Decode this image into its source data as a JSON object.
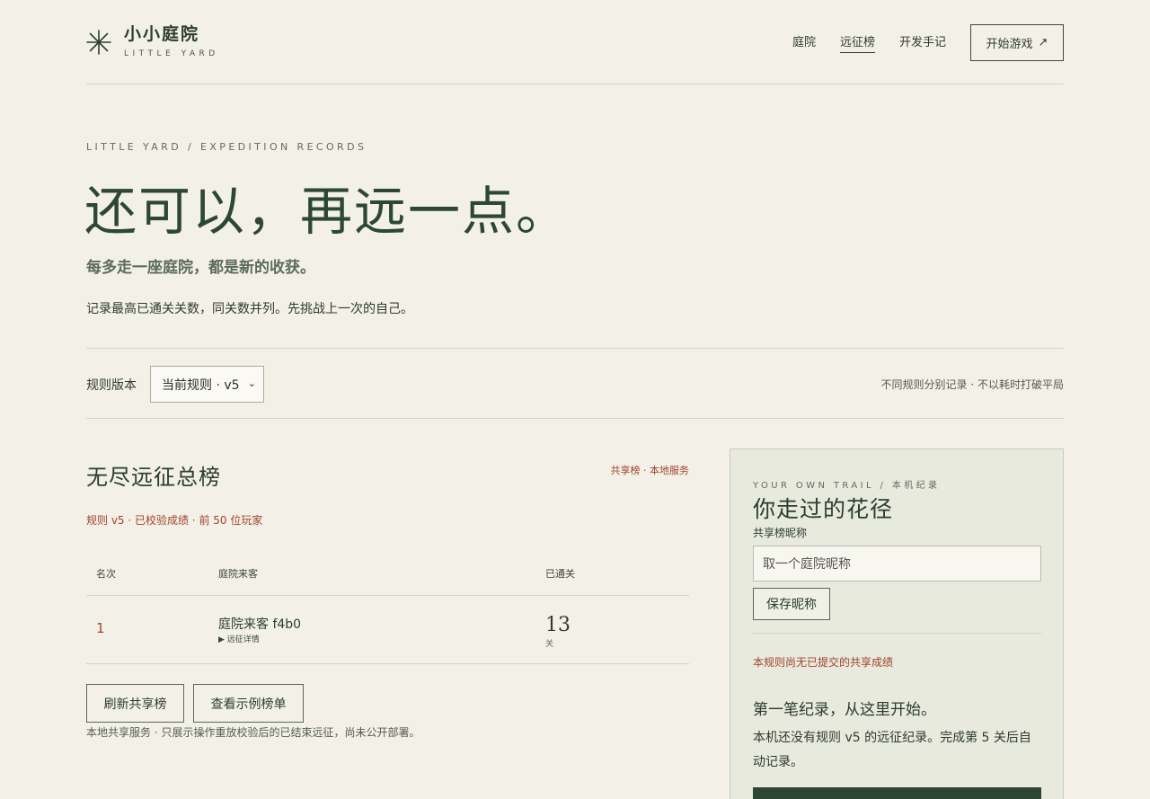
{
  "brand": {
    "name_cn": "小小庭院",
    "name_en": "LITTLE YARD"
  },
  "nav": {
    "items": [
      {
        "label": "庭院"
      },
      {
        "label": "远征榜",
        "active": true
      },
      {
        "label": "开发手记"
      }
    ],
    "start_label": "开始游戏",
    "start_icon": "arrow-up-right-icon"
  },
  "hero": {
    "eyebrow": "LITTLE YARD / EXPEDITION RECORDS",
    "title": "还可以，再远一点。",
    "subtitle": "每多走一座庭院，都是新的收获。",
    "description": "记录最高已通关关数，同关数并列。先挑战上一次的自己。"
  },
  "rules": {
    "label": "规则版本",
    "selected": "当前规则 · v5",
    "note": "不同规则分别记录 · 不以耗时打破平局"
  },
  "board": {
    "title": "无尽远征总榜",
    "tag": "共享榜 · 本地服务",
    "meta": "规则 v5 · 已校验成绩 · 前 50 位玩家",
    "columns": {
      "rank": "名次",
      "guest": "庭院来客",
      "cleared": "已通关"
    },
    "rows": [
      {
        "rank": "1",
        "guest": "庭院来客 f4b0",
        "details": "▶ 远征详情",
        "cleared": "13",
        "unit": "关"
      }
    ],
    "refresh_label": "刷新共享榜",
    "sample_label": "查看示例榜单",
    "footnote": "本地共享服务 · 只展示操作重放校验后的已结束远征，尚未公开部署。"
  },
  "panel": {
    "eyebrow": "YOUR OWN TRAIL / 本机纪录",
    "title": "你走过的花径",
    "nickname_label": "共享榜昵称",
    "nickname_placeholder": "取一个庭院昵称",
    "save_label": "保存昵称",
    "warning": "本规则尚无已提交的共享成绩",
    "heading": "第一笔纪录，从这里开始。",
    "body": "本机还没有规则 v5 的远征纪录。完成第 5 关后自动记录。"
  },
  "colors": {
    "background": "#f3f1e7",
    "accent_green": "#2c4834",
    "accent_red": "#a2432d",
    "panel_bg": "#e7eadd"
  }
}
